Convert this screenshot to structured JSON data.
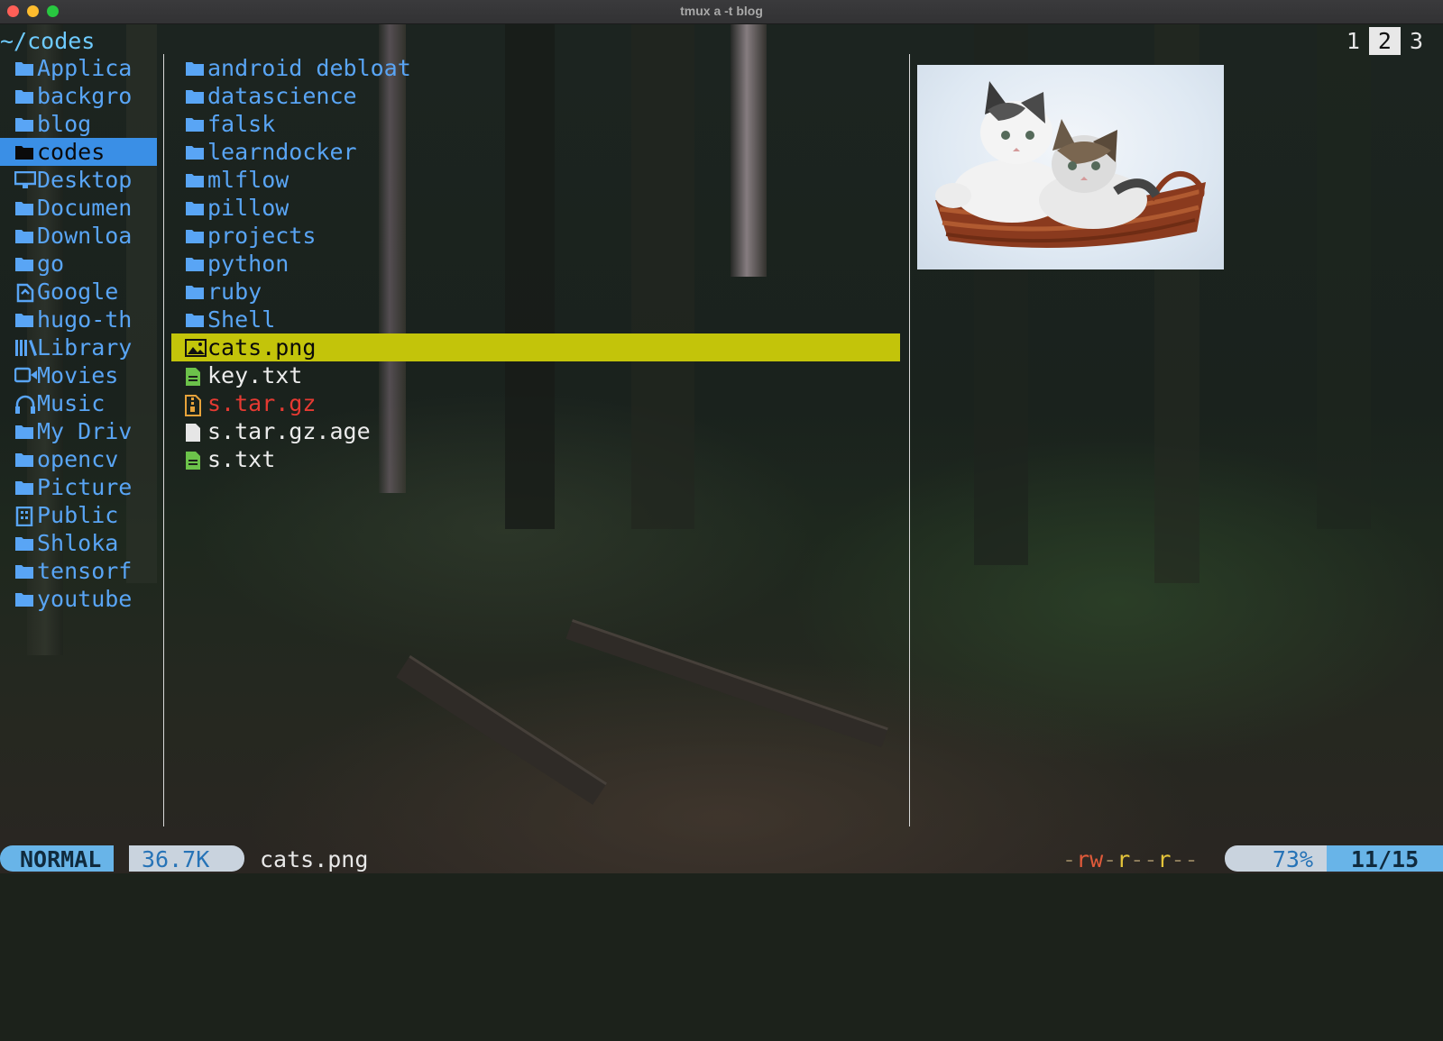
{
  "window": {
    "title": "tmux a -t blog"
  },
  "header": {
    "path": "~/codes",
    "tabs": [
      "1",
      "2",
      "3"
    ],
    "active_tab": "2"
  },
  "parent_dir": {
    "items": [
      {
        "label": "Applica",
        "icon": "folder-icon"
      },
      {
        "label": "backgro",
        "icon": "folder-icon"
      },
      {
        "label": "blog",
        "icon": "folder-icon"
      },
      {
        "label": "codes",
        "icon": "folder-icon",
        "selected": true
      },
      {
        "label": "Desktop",
        "icon": "desktop-icon"
      },
      {
        "label": "Documen",
        "icon": "document-folder-icon"
      },
      {
        "label": "Downloa",
        "icon": "download-folder-icon"
      },
      {
        "label": "go",
        "icon": "folder-icon"
      },
      {
        "label": "Google",
        "icon": "google-drive-icon"
      },
      {
        "label": "hugo-th",
        "icon": "folder-icon"
      },
      {
        "label": "Library",
        "icon": "library-icon"
      },
      {
        "label": "Movies",
        "icon": "video-camera-icon"
      },
      {
        "label": "Music",
        "icon": "headphones-icon"
      },
      {
        "label": "My Driv",
        "icon": "folder-icon"
      },
      {
        "label": "opencv",
        "icon": "folder-icon"
      },
      {
        "label": "Picture",
        "icon": "picture-folder-icon"
      },
      {
        "label": "Public",
        "icon": "building-icon"
      },
      {
        "label": "Shloka",
        "icon": "folder-icon"
      },
      {
        "label": "tensorf",
        "icon": "folder-icon"
      },
      {
        "label": "youtube",
        "icon": "folder-icon"
      }
    ]
  },
  "current_dir": {
    "items": [
      {
        "label": "android debloat",
        "kind": "dir",
        "icon": "folder-icon"
      },
      {
        "label": "datascience",
        "kind": "dir",
        "icon": "folder-icon"
      },
      {
        "label": "falsk",
        "kind": "dir",
        "icon": "folder-icon"
      },
      {
        "label": "learndocker",
        "kind": "dir",
        "icon": "folder-icon"
      },
      {
        "label": "mlflow",
        "kind": "dir",
        "icon": "folder-icon"
      },
      {
        "label": "pillow",
        "kind": "dir",
        "icon": "folder-icon"
      },
      {
        "label": "projects",
        "kind": "dir",
        "icon": "folder-icon"
      },
      {
        "label": "python",
        "kind": "dir",
        "icon": "folder-icon"
      },
      {
        "label": "ruby",
        "kind": "dir",
        "icon": "folder-icon"
      },
      {
        "label": "Shell",
        "kind": "dir",
        "icon": "folder-icon"
      },
      {
        "label": "cats.png",
        "kind": "image",
        "icon": "image-file-icon",
        "selected": true
      },
      {
        "label": "key.txt",
        "kind": "text",
        "icon": "text-file-icon"
      },
      {
        "label": "s.tar.gz",
        "kind": "archive",
        "icon": "archive-file-icon"
      },
      {
        "label": "s.tar.gz.age",
        "kind": "file",
        "icon": "file-icon"
      },
      {
        "label": "s.txt",
        "kind": "text",
        "icon": "text-file-icon"
      }
    ]
  },
  "preview": {
    "description_icon": "cats-image-preview"
  },
  "statusbar": {
    "mode": "NORMAL",
    "size": "36.7K",
    "filename": "cats.png",
    "perm_parts": [
      "-",
      "rw",
      "-",
      "r",
      "--",
      "r",
      "--"
    ],
    "percent": "73%",
    "position": "11/15"
  },
  "colors": {
    "dir": "#59a5f5",
    "selection_current": "#c3c40a",
    "selection_parent": "#3a8fe6",
    "archive": "#e53a32",
    "text_file_icon": "#6cc24a",
    "archive_icon": "#e8a33a",
    "mode_bg": "#68b4e8"
  }
}
